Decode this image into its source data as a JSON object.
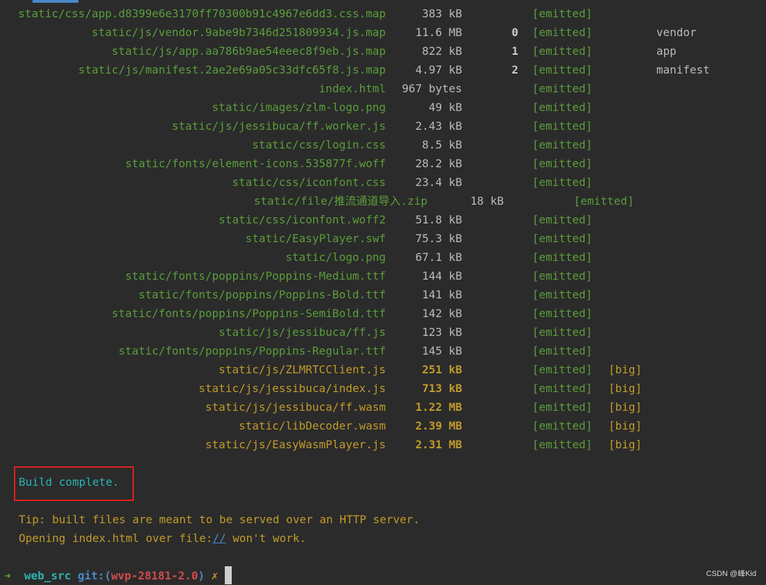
{
  "assets": [
    {
      "file": "static/css/app.d8399e6e3170ff70300b91c4967e6dd3.css.map",
      "size": "383 kB",
      "chunk": "",
      "status": "[emitted]",
      "big": "",
      "name": "",
      "color": "green",
      "shift": false
    },
    {
      "file": "static/js/vendor.9abe9b7346d251809934.js.map",
      "size": "11.6 MB",
      "chunk": "0",
      "status": "[emitted]",
      "big": "",
      "name": "vendor",
      "color": "green",
      "shift": false
    },
    {
      "file": "static/js/app.aa786b9ae54eeec8f9eb.js.map",
      "size": "822 kB",
      "chunk": "1",
      "status": "[emitted]",
      "big": "",
      "name": "app",
      "color": "green",
      "shift": false
    },
    {
      "file": "static/js/manifest.2ae2e69a05c33dfc65f8.js.map",
      "size": "4.97 kB",
      "chunk": "2",
      "status": "[emitted]",
      "big": "",
      "name": "manifest",
      "color": "green",
      "shift": false
    },
    {
      "file": "index.html",
      "size": "967 bytes",
      "chunk": "",
      "status": "[emitted]",
      "big": "",
      "name": "",
      "color": "green",
      "shift": false
    },
    {
      "file": "static/images/zlm-logo.png",
      "size": "49 kB",
      "chunk": "",
      "status": "[emitted]",
      "big": "",
      "name": "",
      "color": "green",
      "shift": false
    },
    {
      "file": "static/js/jessibuca/ff.worker.js",
      "size": "2.43 kB",
      "chunk": "",
      "status": "[emitted]",
      "big": "",
      "name": "",
      "color": "green",
      "shift": false
    },
    {
      "file": "static/css/login.css",
      "size": "8.5 kB",
      "chunk": "",
      "status": "[emitted]",
      "big": "",
      "name": "",
      "color": "green",
      "shift": false
    },
    {
      "file": "static/fonts/element-icons.535877f.woff",
      "size": "28.2 kB",
      "chunk": "",
      "status": "[emitted]",
      "big": "",
      "name": "",
      "color": "green",
      "shift": false
    },
    {
      "file": "static/css/iconfont.css",
      "size": "23.4 kB",
      "chunk": "",
      "status": "[emitted]",
      "big": "",
      "name": "",
      "color": "green",
      "shift": false
    },
    {
      "file": "static/file/推流通道导入.zip",
      "size": "18 kB",
      "chunk": "",
      "status": "[emitted]",
      "big": "",
      "name": "",
      "color": "green",
      "shift": true
    },
    {
      "file": "static/css/iconfont.woff2",
      "size": "51.8 kB",
      "chunk": "",
      "status": "[emitted]",
      "big": "",
      "name": "",
      "color": "green",
      "shift": false
    },
    {
      "file": "static/EasyPlayer.swf",
      "size": "75.3 kB",
      "chunk": "",
      "status": "[emitted]",
      "big": "",
      "name": "",
      "color": "green",
      "shift": false
    },
    {
      "file": "static/logo.png",
      "size": "67.1 kB",
      "chunk": "",
      "status": "[emitted]",
      "big": "",
      "name": "",
      "color": "green",
      "shift": false
    },
    {
      "file": "static/fonts/poppins/Poppins-Medium.ttf",
      "size": "144 kB",
      "chunk": "",
      "status": "[emitted]",
      "big": "",
      "name": "",
      "color": "green",
      "shift": false
    },
    {
      "file": "static/fonts/poppins/Poppins-Bold.ttf",
      "size": "141 kB",
      "chunk": "",
      "status": "[emitted]",
      "big": "",
      "name": "",
      "color": "green",
      "shift": false
    },
    {
      "file": "static/fonts/poppins/Poppins-SemiBold.ttf",
      "size": "142 kB",
      "chunk": "",
      "status": "[emitted]",
      "big": "",
      "name": "",
      "color": "green",
      "shift": false
    },
    {
      "file": "static/js/jessibuca/ff.js",
      "size": "123 kB",
      "chunk": "",
      "status": "[emitted]",
      "big": "",
      "name": "",
      "color": "green",
      "shift": false
    },
    {
      "file": "static/fonts/poppins/Poppins-Regular.ttf",
      "size": "145 kB",
      "chunk": "",
      "status": "[emitted]",
      "big": "",
      "name": "",
      "color": "green",
      "shift": false
    },
    {
      "file": "static/js/ZLMRTCClient.js",
      "size": "251 kB",
      "chunk": "",
      "status": "[emitted]",
      "big": "[big]",
      "name": "",
      "color": "yellow",
      "shift": false
    },
    {
      "file": "static/js/jessibuca/index.js",
      "size": "713 kB",
      "chunk": "",
      "status": "[emitted]",
      "big": "[big]",
      "name": "",
      "color": "yellow",
      "shift": false
    },
    {
      "file": "static/js/jessibuca/ff.wasm",
      "size": "1.22 MB",
      "chunk": "",
      "status": "[emitted]",
      "big": "[big]",
      "name": "",
      "color": "yellow",
      "shift": false
    },
    {
      "file": "static/libDecoder.wasm",
      "size": "2.39 MB",
      "chunk": "",
      "status": "[emitted]",
      "big": "[big]",
      "name": "",
      "color": "yellow",
      "shift": false
    },
    {
      "file": "static/js/EasyWasmPlayer.js",
      "size": "2.31 MB",
      "chunk": "",
      "status": "[emitted]",
      "big": "[big]",
      "name": "",
      "color": "yellow",
      "shift": false
    }
  ],
  "build_message": "Build complete.",
  "tip_line1": "Tip: built files are meant to be served over an HTTP server.",
  "tip_line2_before": "Opening index.html over file:",
  "tip_line2_link": "//",
  "tip_line2_after": " won't work.",
  "prompt": {
    "arrow": "➜",
    "directory": "web_src",
    "git_label": "git:(",
    "branch": "wvp-28181-2.0",
    "git_close": ")",
    "dirty_marker": "✗"
  },
  "watermark": "CSDN @峰Kid",
  "colors": {
    "background": "#2b2b2b",
    "green": "#5a9e3a",
    "yellow": "#c09a2a",
    "cyan": "#2bb3b0",
    "highlight_box": "#e02020"
  }
}
